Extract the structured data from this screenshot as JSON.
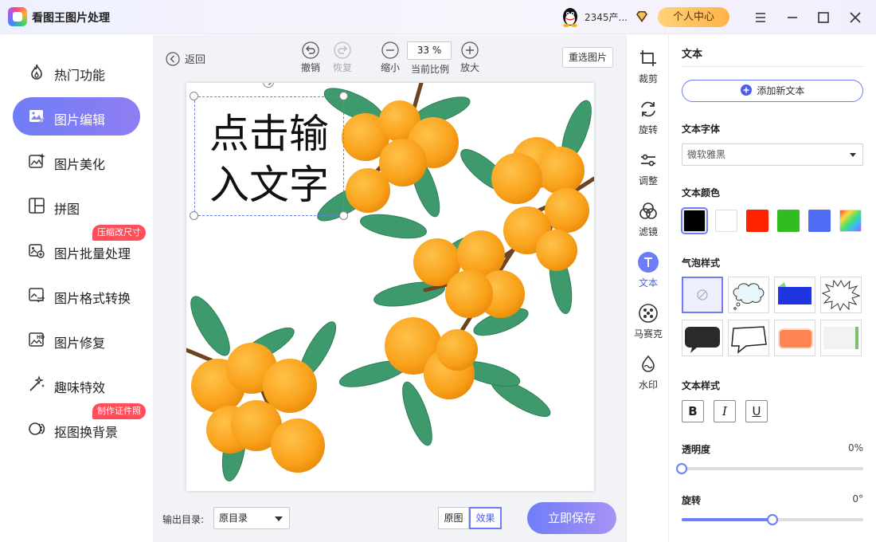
{
  "app": {
    "title": "看图王图片处理",
    "user": "2345产...",
    "personal_center": "个人中心"
  },
  "sidebar": {
    "items": [
      {
        "label": "热门功能"
      },
      {
        "label": "图片编辑",
        "active": true
      },
      {
        "label": "图片美化"
      },
      {
        "label": "拼图"
      },
      {
        "label": "图片批量处理",
        "badge": "压缩改尺寸"
      },
      {
        "label": "图片格式转换"
      },
      {
        "label": "图片修复"
      },
      {
        "label": "趣味特效"
      },
      {
        "label": "抠图换背景",
        "badge": "制作证件照"
      }
    ]
  },
  "toolbar": {
    "back": "返回",
    "undo": "撤销",
    "redo": "恢复",
    "zoom_out": "缩小",
    "zoom_value": "33 %",
    "zoom_label": "当前比例",
    "zoom_in": "放大",
    "reselect": "重选图片"
  },
  "canvas": {
    "text": "点击输\n入文字"
  },
  "footer": {
    "output_label": "输出目录:",
    "output_value": "原目录",
    "view_original": "原图",
    "view_effect": "效果",
    "save": "立即保存"
  },
  "tools": [
    {
      "label": "裁剪",
      "icon": "crop-icon"
    },
    {
      "label": "旋转",
      "icon": "rotate-icon"
    },
    {
      "label": "调整",
      "icon": "adjust-icon"
    },
    {
      "label": "滤镜",
      "icon": "filter-icon"
    },
    {
      "label": "文本",
      "icon": "text-icon",
      "active": true
    },
    {
      "label": "马赛克",
      "icon": "mosaic-icon"
    },
    {
      "label": "水印",
      "icon": "watermark-icon"
    }
  ],
  "panel": {
    "title": "文本",
    "add_text": "添加新文本",
    "font_label": "文本字体",
    "font_value": "微软雅黑",
    "color_label": "文本颜色",
    "colors": [
      "#000000",
      "#ffffff",
      "#ff2200",
      "#33bb22",
      "#4f6cf5",
      "rainbow"
    ],
    "bubble_label": "气泡样式",
    "style_label": "文本样式",
    "bold": "B",
    "italic": "I",
    "underline": "U",
    "opacity_label": "透明度",
    "opacity_value": "0%",
    "opacity": 0,
    "rotate_label": "旋转",
    "rotate_value": "0°",
    "rotate": 0.5
  },
  "colors": {
    "accent": "#6d7df5",
    "badge": "#ff4d5a"
  }
}
